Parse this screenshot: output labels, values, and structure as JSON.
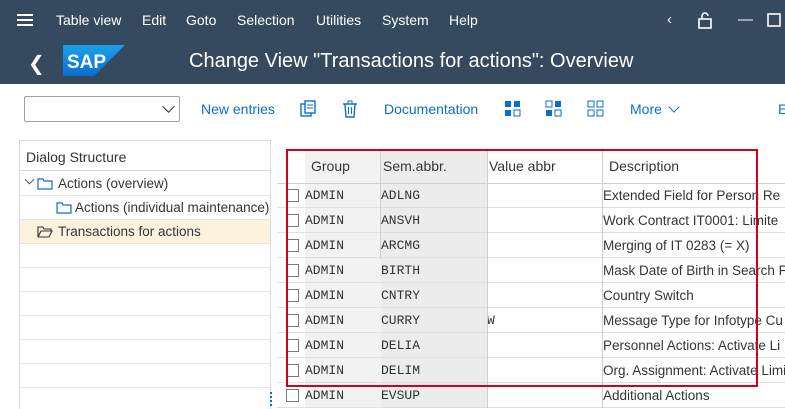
{
  "menu": {
    "items": [
      "Table view",
      "Edit",
      "Goto",
      "Selection",
      "Utilities",
      "System",
      "Help"
    ]
  },
  "header": {
    "title": "Change View \"Transactions for actions\": Overview",
    "logo_text": "SAP"
  },
  "toolbar": {
    "new_entries": "New entries",
    "documentation": "Documentation",
    "more": "More",
    "cut_label": "E"
  },
  "dialog": {
    "title": "Dialog Structure",
    "items": [
      {
        "label": "Actions (overview)"
      },
      {
        "label": "Actions (individual maintenance)"
      },
      {
        "label": "Transactions for actions"
      }
    ]
  },
  "table": {
    "headers": [
      "Group",
      "Sem.abbr.",
      "Value abbr",
      "Description"
    ],
    "rows": [
      {
        "group": "ADMIN",
        "sem": "ADLNG",
        "value": "",
        "desc": "Extended Field for Person Re"
      },
      {
        "group": "ADMIN",
        "sem": "ANSVH",
        "value": "",
        "desc": "Work Contract IT0001: Limite"
      },
      {
        "group": "ADMIN",
        "sem": "ARCMG",
        "value": "",
        "desc": "Merging of IT 0283 (= X)"
      },
      {
        "group": "ADMIN",
        "sem": "BIRTH",
        "value": "",
        "desc": "Mask Date of Birth in Search F"
      },
      {
        "group": "ADMIN",
        "sem": "CNTRY",
        "value": "",
        "desc": "Country Switch"
      },
      {
        "group": "ADMIN",
        "sem": "CURRY",
        "value": "W",
        "desc": "Message Type for Infotype Cu"
      },
      {
        "group": "ADMIN",
        "sem": "DELIA",
        "value": "",
        "desc": "Personnel Actions: Activate Li"
      },
      {
        "group": "ADMIN",
        "sem": "DELIM",
        "value": "",
        "desc": "Org. Assignment: Activate Limi"
      },
      {
        "group": "ADMIN",
        "sem": "EVSUP",
        "value": "",
        "desc": "Additional Actions"
      }
    ]
  },
  "colors": {
    "shell": "#354a5f",
    "link": "#0a6ed1",
    "highlight": "#d0021b",
    "selected": "#fdf3dc"
  }
}
